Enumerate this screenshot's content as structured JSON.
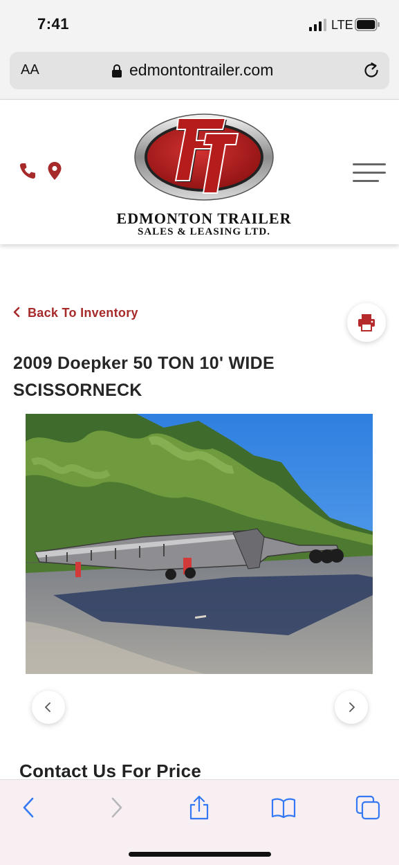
{
  "status_bar": {
    "time": "7:41",
    "network": "LTE"
  },
  "browser": {
    "text_size_label": "AA",
    "url": "edmontontrailer.com"
  },
  "site": {
    "logo_monogram": "ET",
    "logo_title": "EDMONTON TRAILER",
    "logo_subtitle": "SALES & LEASING LTD."
  },
  "listing": {
    "back_label": "Back To Inventory",
    "title": "2009 Doepker 50 TON 10' WIDE SCISSORNECK",
    "contact_heading": "Contact Us For Price"
  },
  "colors": {
    "brand_red": "#a72a2a",
    "ios_blue": "#3478f6"
  },
  "icons": [
    "phone-icon",
    "map-pin-icon",
    "hamburger-menu-icon",
    "printer-icon",
    "chevron-left-icon",
    "chevron-right-icon",
    "lock-icon",
    "reload-icon",
    "share-icon",
    "bookmarks-icon",
    "tabs-icon"
  ]
}
